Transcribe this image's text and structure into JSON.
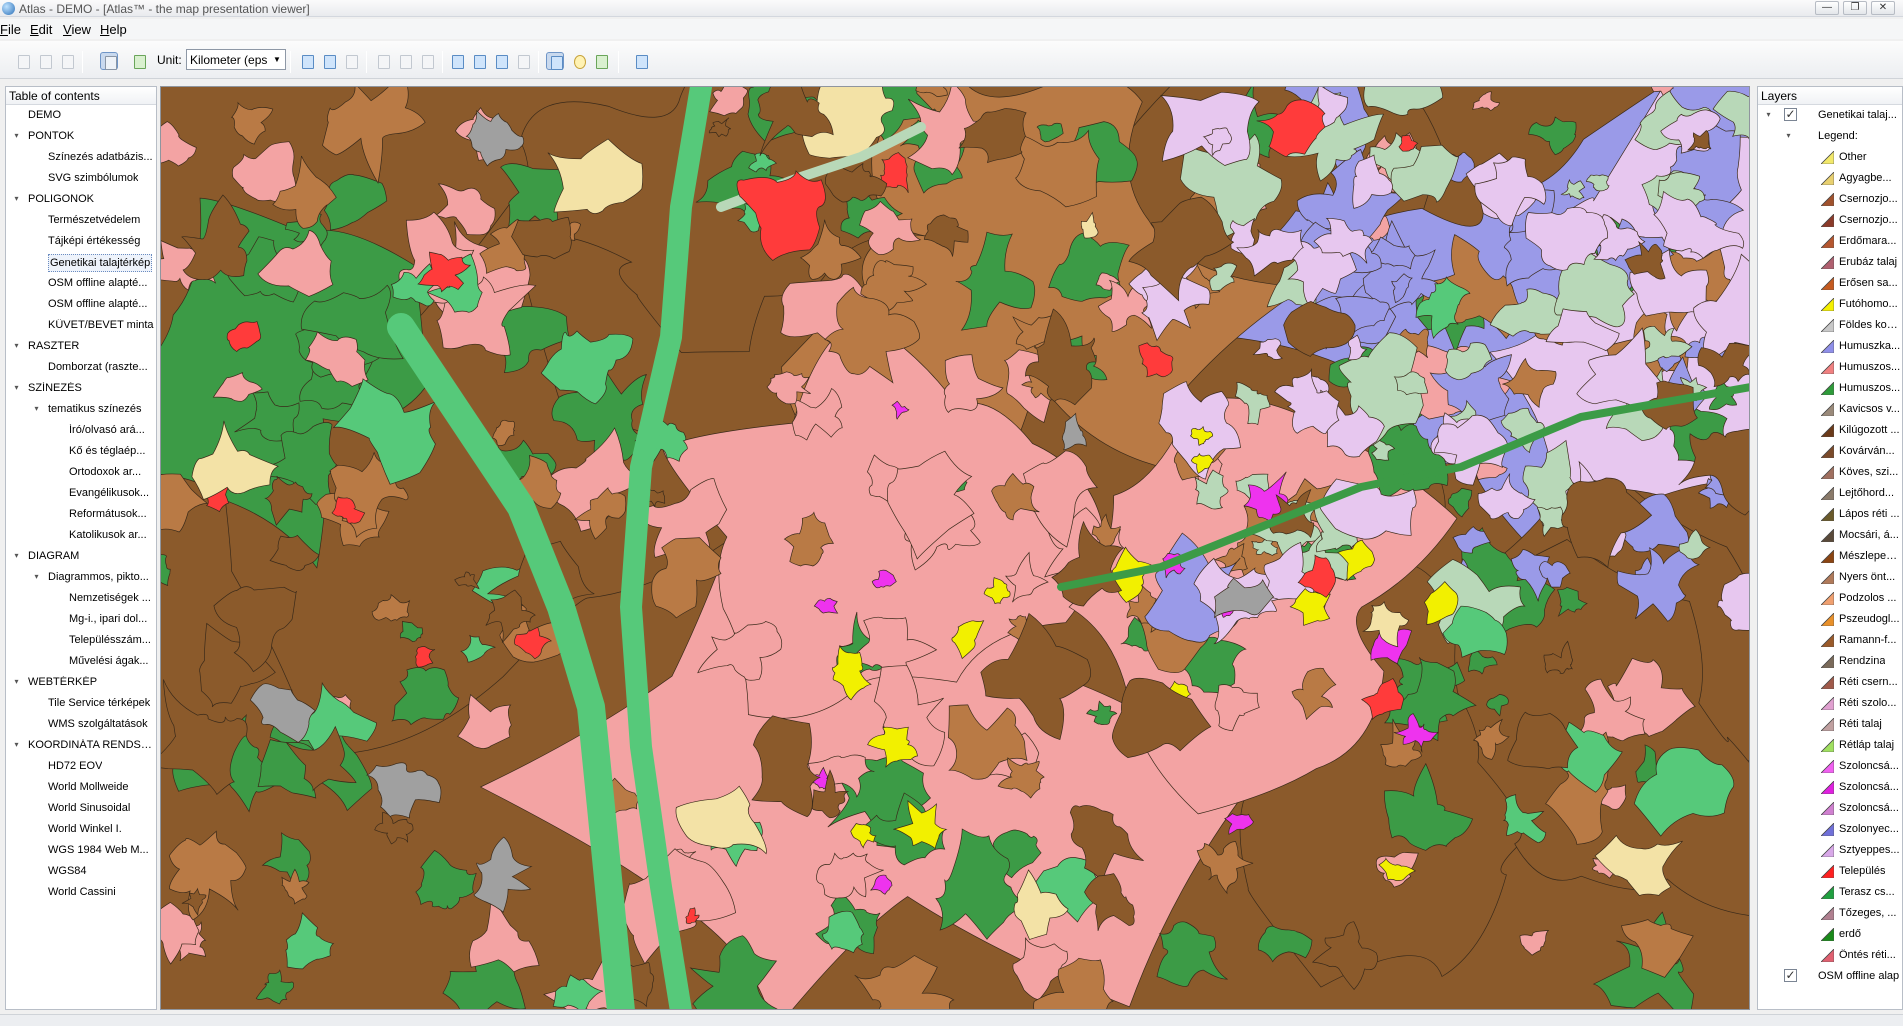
{
  "window": {
    "title": "Atlas - DEMO - [Atlas™ - the map presentation viewer]",
    "minimize": "—",
    "restore": "❐",
    "close": "✕"
  },
  "menu": [
    "File",
    "Edit",
    "View",
    "Help"
  ],
  "toolbar": {
    "unit_label": "Unit:",
    "unit_value": "Kilometer (eps"
  },
  "toc": {
    "header": "Table of contents",
    "items": [
      {
        "label": "DEMO",
        "level": 1,
        "toggle": ""
      },
      {
        "label": "PONTOK",
        "level": 1,
        "toggle": "▾"
      },
      {
        "label": "Színezés adatbázis...",
        "level": 2,
        "toggle": ""
      },
      {
        "label": "SVG szimbólumok",
        "level": 2,
        "toggle": ""
      },
      {
        "label": "POLIGONOK",
        "level": 1,
        "toggle": "▾"
      },
      {
        "label": "Természetvédelem",
        "level": 2,
        "toggle": ""
      },
      {
        "label": "Tájképi értékesség",
        "level": 2,
        "toggle": ""
      },
      {
        "label": "Genetikai talajtérkép",
        "level": 2,
        "toggle": "",
        "selected": true
      },
      {
        "label": "OSM offline alapté...",
        "level": 2,
        "toggle": ""
      },
      {
        "label": "OSM offline alapté...",
        "level": 2,
        "toggle": ""
      },
      {
        "label": "KÜVET/BEVET minta",
        "level": 2,
        "toggle": ""
      },
      {
        "label": "RASZTER",
        "level": 1,
        "toggle": "▾"
      },
      {
        "label": "Domborzat (raszte...",
        "level": 2,
        "toggle": ""
      },
      {
        "label": "SZÍNEZÉS",
        "level": 1,
        "toggle": "▾"
      },
      {
        "label": "tematikus színezés",
        "level": 2,
        "toggle": "▾"
      },
      {
        "label": "Író/olvasó ará...",
        "level": 3,
        "toggle": ""
      },
      {
        "label": "Kő és téglaép...",
        "level": 3,
        "toggle": ""
      },
      {
        "label": "Ortodoxok ar...",
        "level": 3,
        "toggle": ""
      },
      {
        "label": "Evangélikusok...",
        "level": 3,
        "toggle": ""
      },
      {
        "label": "Reformátusok...",
        "level": 3,
        "toggle": ""
      },
      {
        "label": "Katolikusok ar...",
        "level": 3,
        "toggle": ""
      },
      {
        "label": "DIAGRAM",
        "level": 1,
        "toggle": "▾"
      },
      {
        "label": "Diagrammos, pikto...",
        "level": 2,
        "toggle": "▾"
      },
      {
        "label": "Nemzetiségek ...",
        "level": 3,
        "toggle": ""
      },
      {
        "label": "Mg-i., ipari dol...",
        "level": 3,
        "toggle": ""
      },
      {
        "label": "Településszám...",
        "level": 3,
        "toggle": ""
      },
      {
        "label": "Művelési ágak...",
        "level": 3,
        "toggle": ""
      },
      {
        "label": "WEBTÉRKÉP",
        "level": 1,
        "toggle": "▾"
      },
      {
        "label": "Tile Service térképek",
        "level": 2,
        "toggle": ""
      },
      {
        "label": "WMS szolgáltatások",
        "level": 2,
        "toggle": ""
      },
      {
        "label": "KOORDINÁTA RENDSZ...",
        "level": 1,
        "toggle": "▾"
      },
      {
        "label": "HD72 EOV",
        "level": 2,
        "toggle": ""
      },
      {
        "label": "World Mollweide",
        "level": 2,
        "toggle": ""
      },
      {
        "label": "World Sinusoidal",
        "level": 2,
        "toggle": ""
      },
      {
        "label": "World Winkel I.",
        "level": 2,
        "toggle": ""
      },
      {
        "label": "WGS 1984 Web M...",
        "level": 2,
        "toggle": ""
      },
      {
        "label": "WGS84",
        "level": 2,
        "toggle": ""
      },
      {
        "label": "World Cassini",
        "level": 2,
        "toggle": ""
      }
    ]
  },
  "layers": {
    "header": "Layers",
    "top_layer": "Genetikai talaj...",
    "legend_label": "Legend:",
    "bottom_layer": "OSM offline alap",
    "legend": [
      {
        "label": "Other",
        "color": "#f2e86a"
      },
      {
        "label": "Agyagbe...",
        "color": "#e8d070"
      },
      {
        "label": "Csernozjo...",
        "color": "#a0522d"
      },
      {
        "label": "Csernozjo...",
        "color": "#8b3a2a"
      },
      {
        "label": "Erdőmara...",
        "color": "#b5562f"
      },
      {
        "label": "Erubáz talaj",
        "color": "#b06070"
      },
      {
        "label": "Erősen sa...",
        "color": "#c45a1f"
      },
      {
        "label": "Futóhomo...",
        "color": "#f5f000"
      },
      {
        "label": "Földes kopár",
        "color": "#c8c8c8"
      },
      {
        "label": "Humuszka...",
        "color": "#8f8fe8"
      },
      {
        "label": "Humuszos...",
        "color": "#f08080"
      },
      {
        "label": "Humuszos...",
        "color": "#2e9b3a"
      },
      {
        "label": "Kavicsos v...",
        "color": "#9a8a7a"
      },
      {
        "label": "Kilúgozott ...",
        "color": "#6b3a1a"
      },
      {
        "label": "Kovárván...",
        "color": "#7a4a2a"
      },
      {
        "label": "Köves, szi...",
        "color": "#a07060"
      },
      {
        "label": "Lejtőhord...",
        "color": "#8a7a6a"
      },
      {
        "label": "Lápos réti ...",
        "color": "#6a5a2a"
      },
      {
        "label": "Mocsári, á...",
        "color": "#5a4a3a"
      },
      {
        "label": "Mészleped...",
        "color": "#8b4513"
      },
      {
        "label": "Nyers önt...",
        "color": "#b07a5a"
      },
      {
        "label": "Podzolos ...",
        "color": "#f0a070"
      },
      {
        "label": "Pszeudogl...",
        "color": "#e8902a"
      },
      {
        "label": "Ramann-f...",
        "color": "#9a5a2a"
      },
      {
        "label": "Rendzina",
        "color": "#7a6a5a"
      },
      {
        "label": "Réti csern...",
        "color": "#a05a4a"
      },
      {
        "label": "Réti szolo...",
        "color": "#e0a0d0"
      },
      {
        "label": "Réti talaj",
        "color": "#c0a0a0"
      },
      {
        "label": "Rétláp talaj",
        "color": "#a0e060"
      },
      {
        "label": "Szoloncsá...",
        "color": "#f060f0"
      },
      {
        "label": "Szoloncsá...",
        "color": "#e020e0"
      },
      {
        "label": "Szoloncsá...",
        "color": "#d080d0"
      },
      {
        "label": "Szolonyec...",
        "color": "#7070d8"
      },
      {
        "label": "Sztyeppes...",
        "color": "#d8a8e8"
      },
      {
        "label": "Település",
        "color": "#ff2020"
      },
      {
        "label": "Terasz cs...",
        "color": "#20a040"
      },
      {
        "label": "Tőzeges, ...",
        "color": "#b08090"
      },
      {
        "label": "erdő",
        "color": "#1a8a1a"
      },
      {
        "label": "Öntés réti...",
        "color": "#e06070"
      }
    ]
  },
  "map_colors": {
    "brown": "#8b5a2b",
    "tan": "#b97a45",
    "pink": "#f3a3a3",
    "green": "#3c9b46",
    "lightgreen": "#56c97a",
    "paleblue": "#9a9ae8",
    "palegreen": "#b8d8b8",
    "lilac": "#e7c7ef",
    "red": "#ff3b3b",
    "yellow": "#f2f000",
    "magenta": "#ee33ee",
    "cream": "#f3e2a6",
    "gray": "#a0a0a0"
  }
}
